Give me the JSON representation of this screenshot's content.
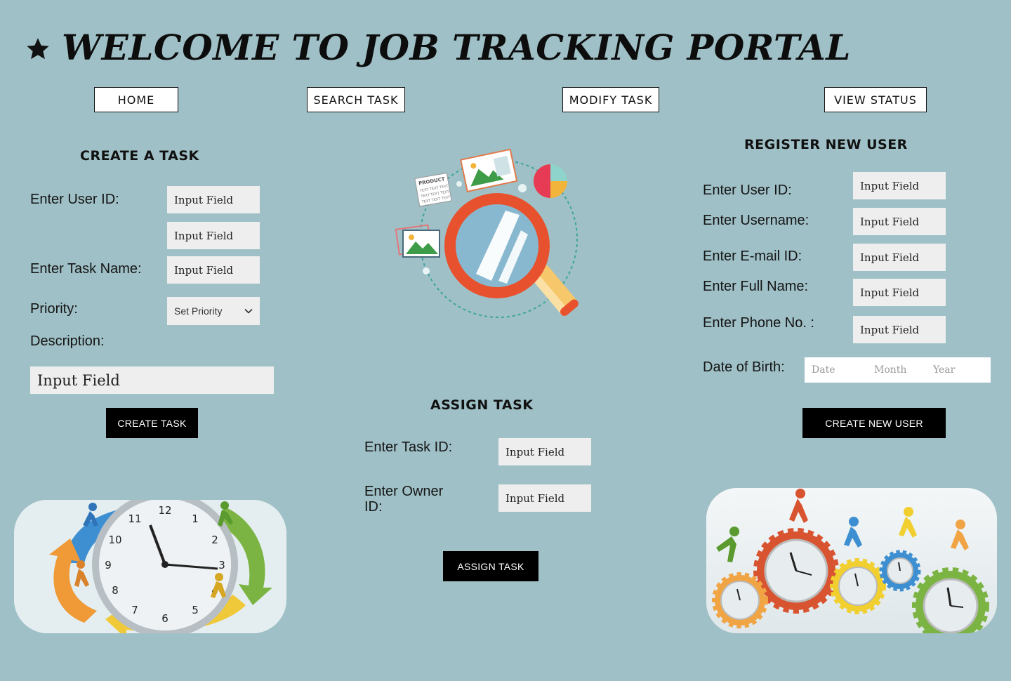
{
  "header": {
    "title": "WELCOME TO JOB TRACKING PORTAL",
    "icon": "star-icon"
  },
  "nav": {
    "home": "HOME",
    "search": "SEARCH TASK",
    "modify": "MODIFY TASK",
    "status": "VIEW STATUS"
  },
  "create_task": {
    "title": "CREATE A TASK",
    "user_id_label": "Enter User ID:",
    "user_id_value": "Input Field",
    "extra_value": "Input Field",
    "task_name_label": "Enter Task Name:",
    "task_name_value": "Input Field",
    "priority_label": "Priority:",
    "priority_value": "Set Priority",
    "description_label": "Description:",
    "description_value": "Input Field",
    "button": "CREATE TASK"
  },
  "assign_task": {
    "title": "ASSIGN TASK",
    "task_id_label": "Enter Task ID:",
    "task_id_value": "Input Field",
    "owner_id_label_1": "Enter Owner",
    "owner_id_label_2": "ID:",
    "owner_id_value": "Input Field",
    "button": "ASSIGN TASK"
  },
  "register": {
    "title": "REGISTER NEW USER",
    "user_id_label": "Enter User ID:",
    "user_id_value": "Input Field",
    "username_label": "Enter Username:",
    "username_value": "Input Field",
    "email_label": "Enter E-mail ID:",
    "email_value": "Input Field",
    "fullname_label": "Enter Full Name:",
    "fullname_value": "Input Field",
    "phone_label": "Enter Phone No. :",
    "phone_value": "Input Field",
    "dob_label": "Date of Birth:",
    "dob_date": "Date",
    "dob_month": "Month",
    "dob_year": "Year",
    "button": "CREATE NEW USER"
  },
  "illustration": {
    "product_text": "PRODUCT",
    "filler_text": "TEXT TEXT TEXT"
  },
  "colors": {
    "background": "#9fc0c6",
    "input_bg": "#eeeeee",
    "button_dark": "#000000",
    "magnifier_red": "#e8512d"
  }
}
